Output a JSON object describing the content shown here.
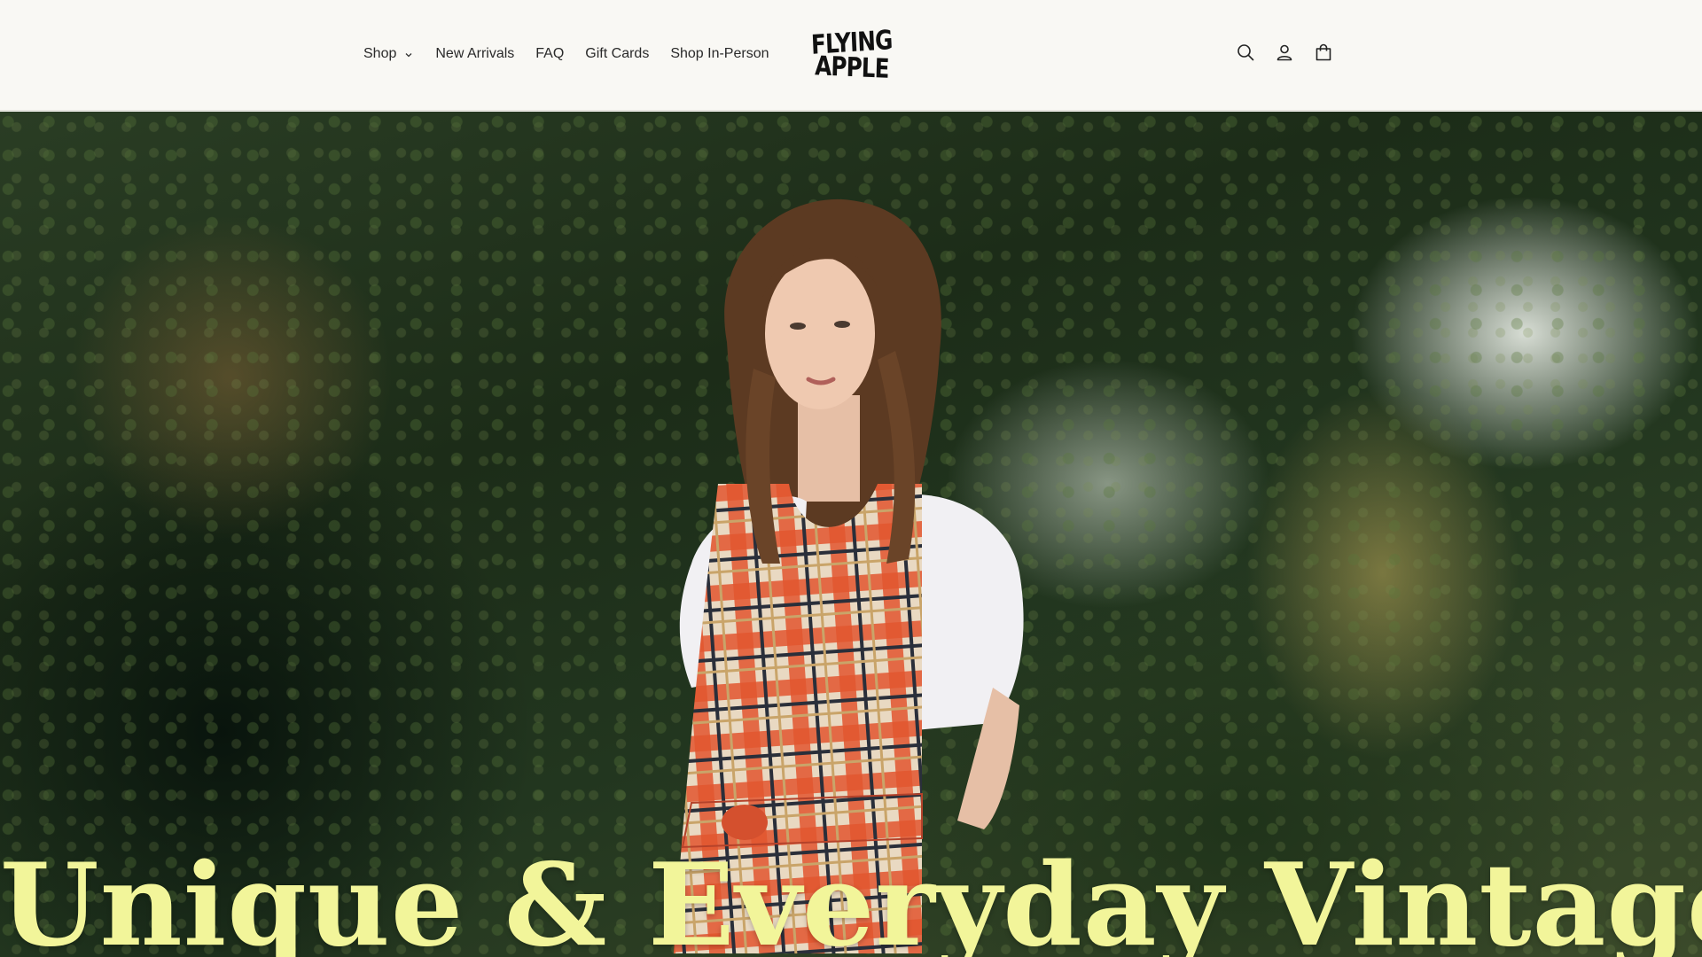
{
  "header": {
    "nav": [
      {
        "label": "Shop",
        "has_dropdown": true
      },
      {
        "label": "New Arrivals"
      },
      {
        "label": "FAQ"
      },
      {
        "label": "Gift Cards"
      },
      {
        "label": "Shop In-Person"
      }
    ],
    "logo": {
      "line1": "FLYING",
      "line2": "APPLE"
    },
    "icons": [
      "search-icon",
      "account-icon",
      "cart-icon"
    ]
  },
  "hero": {
    "headline": "Unique & Everyday Vintage",
    "headline_color": "#f2f59a"
  },
  "colors": {
    "header_bg": "#f9f8f4",
    "text": "#2a2a2a"
  }
}
